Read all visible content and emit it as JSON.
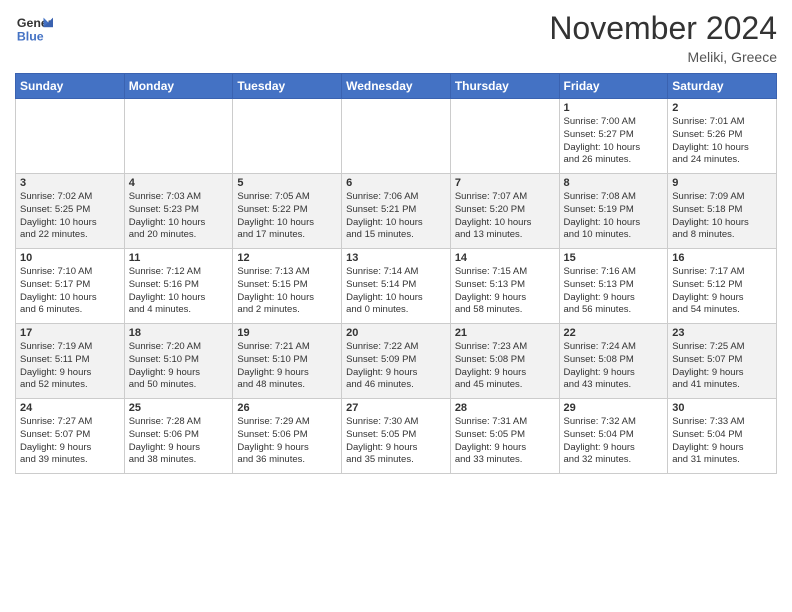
{
  "header": {
    "logo_line1": "General",
    "logo_line2": "Blue",
    "month": "November 2024",
    "location": "Meliki, Greece"
  },
  "weekdays": [
    "Sunday",
    "Monday",
    "Tuesday",
    "Wednesday",
    "Thursday",
    "Friday",
    "Saturday"
  ],
  "weeks": [
    [
      {
        "day": "",
        "info": ""
      },
      {
        "day": "",
        "info": ""
      },
      {
        "day": "",
        "info": ""
      },
      {
        "day": "",
        "info": ""
      },
      {
        "day": "",
        "info": ""
      },
      {
        "day": "1",
        "info": "Sunrise: 7:00 AM\nSunset: 5:27 PM\nDaylight: 10 hours\nand 26 minutes."
      },
      {
        "day": "2",
        "info": "Sunrise: 7:01 AM\nSunset: 5:26 PM\nDaylight: 10 hours\nand 24 minutes."
      }
    ],
    [
      {
        "day": "3",
        "info": "Sunrise: 7:02 AM\nSunset: 5:25 PM\nDaylight: 10 hours\nand 22 minutes."
      },
      {
        "day": "4",
        "info": "Sunrise: 7:03 AM\nSunset: 5:23 PM\nDaylight: 10 hours\nand 20 minutes."
      },
      {
        "day": "5",
        "info": "Sunrise: 7:05 AM\nSunset: 5:22 PM\nDaylight: 10 hours\nand 17 minutes."
      },
      {
        "day": "6",
        "info": "Sunrise: 7:06 AM\nSunset: 5:21 PM\nDaylight: 10 hours\nand 15 minutes."
      },
      {
        "day": "7",
        "info": "Sunrise: 7:07 AM\nSunset: 5:20 PM\nDaylight: 10 hours\nand 13 minutes."
      },
      {
        "day": "8",
        "info": "Sunrise: 7:08 AM\nSunset: 5:19 PM\nDaylight: 10 hours\nand 10 minutes."
      },
      {
        "day": "9",
        "info": "Sunrise: 7:09 AM\nSunset: 5:18 PM\nDaylight: 10 hours\nand 8 minutes."
      }
    ],
    [
      {
        "day": "10",
        "info": "Sunrise: 7:10 AM\nSunset: 5:17 PM\nDaylight: 10 hours\nand 6 minutes."
      },
      {
        "day": "11",
        "info": "Sunrise: 7:12 AM\nSunset: 5:16 PM\nDaylight: 10 hours\nand 4 minutes."
      },
      {
        "day": "12",
        "info": "Sunrise: 7:13 AM\nSunset: 5:15 PM\nDaylight: 10 hours\nand 2 minutes."
      },
      {
        "day": "13",
        "info": "Sunrise: 7:14 AM\nSunset: 5:14 PM\nDaylight: 10 hours\nand 0 minutes."
      },
      {
        "day": "14",
        "info": "Sunrise: 7:15 AM\nSunset: 5:13 PM\nDaylight: 9 hours\nand 58 minutes."
      },
      {
        "day": "15",
        "info": "Sunrise: 7:16 AM\nSunset: 5:13 PM\nDaylight: 9 hours\nand 56 minutes."
      },
      {
        "day": "16",
        "info": "Sunrise: 7:17 AM\nSunset: 5:12 PM\nDaylight: 9 hours\nand 54 minutes."
      }
    ],
    [
      {
        "day": "17",
        "info": "Sunrise: 7:19 AM\nSunset: 5:11 PM\nDaylight: 9 hours\nand 52 minutes."
      },
      {
        "day": "18",
        "info": "Sunrise: 7:20 AM\nSunset: 5:10 PM\nDaylight: 9 hours\nand 50 minutes."
      },
      {
        "day": "19",
        "info": "Sunrise: 7:21 AM\nSunset: 5:10 PM\nDaylight: 9 hours\nand 48 minutes."
      },
      {
        "day": "20",
        "info": "Sunrise: 7:22 AM\nSunset: 5:09 PM\nDaylight: 9 hours\nand 46 minutes."
      },
      {
        "day": "21",
        "info": "Sunrise: 7:23 AM\nSunset: 5:08 PM\nDaylight: 9 hours\nand 45 minutes."
      },
      {
        "day": "22",
        "info": "Sunrise: 7:24 AM\nSunset: 5:08 PM\nDaylight: 9 hours\nand 43 minutes."
      },
      {
        "day": "23",
        "info": "Sunrise: 7:25 AM\nSunset: 5:07 PM\nDaylight: 9 hours\nand 41 minutes."
      }
    ],
    [
      {
        "day": "24",
        "info": "Sunrise: 7:27 AM\nSunset: 5:07 PM\nDaylight: 9 hours\nand 39 minutes."
      },
      {
        "day": "25",
        "info": "Sunrise: 7:28 AM\nSunset: 5:06 PM\nDaylight: 9 hours\nand 38 minutes."
      },
      {
        "day": "26",
        "info": "Sunrise: 7:29 AM\nSunset: 5:06 PM\nDaylight: 9 hours\nand 36 minutes."
      },
      {
        "day": "27",
        "info": "Sunrise: 7:30 AM\nSunset: 5:05 PM\nDaylight: 9 hours\nand 35 minutes."
      },
      {
        "day": "28",
        "info": "Sunrise: 7:31 AM\nSunset: 5:05 PM\nDaylight: 9 hours\nand 33 minutes."
      },
      {
        "day": "29",
        "info": "Sunrise: 7:32 AM\nSunset: 5:04 PM\nDaylight: 9 hours\nand 32 minutes."
      },
      {
        "day": "30",
        "info": "Sunrise: 7:33 AM\nSunset: 5:04 PM\nDaylight: 9 hours\nand 31 minutes."
      }
    ]
  ]
}
